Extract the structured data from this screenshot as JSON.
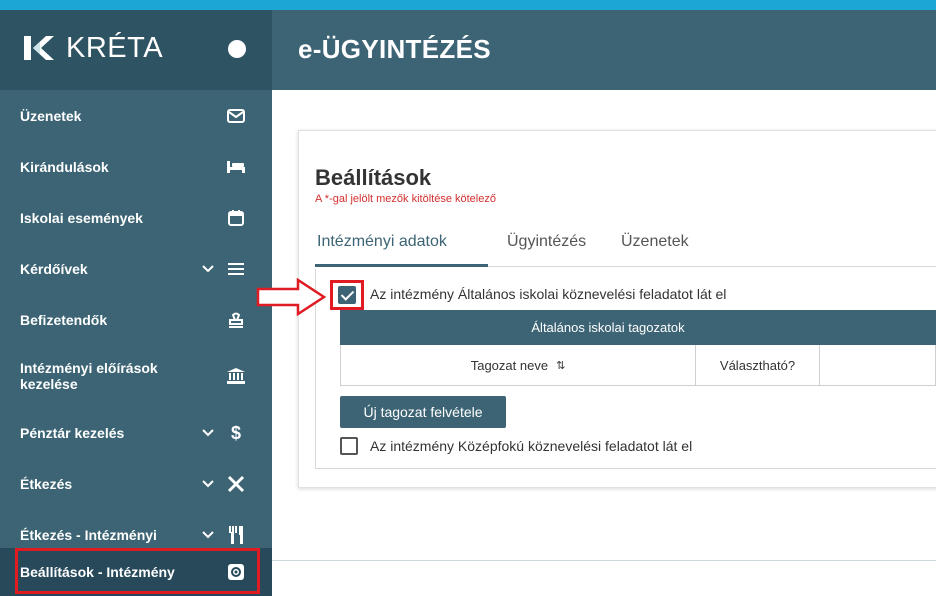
{
  "app": {
    "logo_text": "KRÉTA",
    "page_title": "e-ÜGYINTÉZÉS"
  },
  "sidebar": {
    "items": [
      {
        "label": "Üzenetek",
        "icon": "envelope-icon",
        "has_chevron": false
      },
      {
        "label": "Kirándulások",
        "icon": "bed-icon",
        "has_chevron": false
      },
      {
        "label": "Iskolai események",
        "icon": "calendar-icon",
        "has_chevron": false
      },
      {
        "label": "Kérdőívek",
        "icon": "list-icon",
        "has_chevron": true
      },
      {
        "label": "Befizetendők",
        "icon": "stamp-icon",
        "has_chevron": false
      },
      {
        "label": "Intézményi előírások kezelése",
        "icon": "institution-icon",
        "has_chevron": false
      },
      {
        "label": "Pénztár kezelés",
        "icon": "dollar-icon",
        "has_chevron": true
      },
      {
        "label": "Étkezés",
        "icon": "utensils-cross-icon",
        "has_chevron": true
      },
      {
        "label": "Étkezés - Intézményi",
        "icon": "fork-knife-icon",
        "has_chevron": true
      },
      {
        "label": "Beállítások - Intézmény",
        "icon": "gear-icon",
        "has_chevron": false,
        "active": true
      }
    ]
  },
  "settings": {
    "title": "Beállítások",
    "required_note": "A *-gal jelölt mezők kitöltése kötelező",
    "tabs": [
      {
        "label": "Intézményi adatok",
        "active": true
      },
      {
        "label": "Ügyintézés",
        "active": false
      },
      {
        "label": "Üzenetek",
        "active": false
      }
    ],
    "checkbox_general": {
      "label": "Az intézmény Általános iskolai köznevelési feladatot lát el",
      "checked": true
    },
    "table": {
      "title": "Általános iskolai tagozatok",
      "col_name": "Tagozat neve",
      "sort_icon": "⇅",
      "col_selectable": "Választható?"
    },
    "add_button": "Új tagozat felvétele",
    "checkbox_secondary": {
      "label": "Az intézmény Középfokú köznevelési feladatot lát el",
      "checked": false
    }
  },
  "colors": {
    "primary": "#3c6474",
    "header_dark": "#2e5363",
    "accent_top": "#1ba6d6",
    "highlight_red": "#e01b22"
  }
}
